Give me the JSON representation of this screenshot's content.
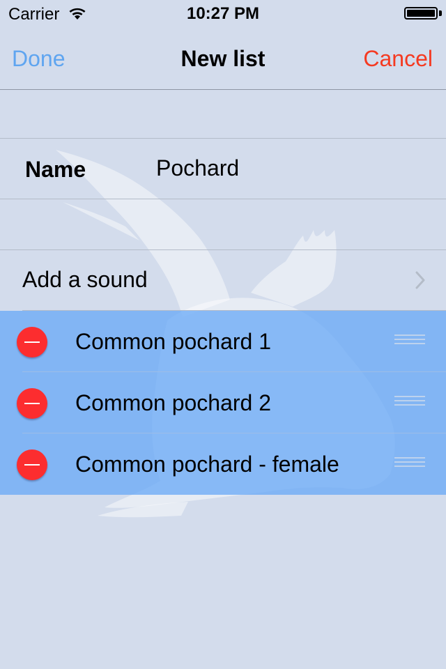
{
  "status_bar": {
    "carrier": "Carrier",
    "time": "10:27 PM",
    "wifi_icon": "wifi-icon",
    "battery_icon": "battery-icon"
  },
  "nav": {
    "done_label": "Done",
    "title": "New list",
    "cancel_label": "Cancel",
    "colors": {
      "done": "#5fa5f0",
      "cancel": "#f53a21"
    }
  },
  "form": {
    "name_label": "Name",
    "name_value": "Pochard"
  },
  "add_sound": {
    "label": "Add a sound",
    "icon": "chevron-right-icon"
  },
  "sounds": [
    {
      "label": "Common pochard 1"
    },
    {
      "label": "Common pochard 2"
    },
    {
      "label": "Common pochard - female"
    }
  ],
  "icons": {
    "delete": "minus-circle-icon",
    "reorder": "reorder-handle-icon",
    "background": "bird-silhouette-icon"
  },
  "colors": {
    "background": "#d3dcec",
    "list_highlight": "#6baaf6",
    "delete": "#fc2d2f"
  }
}
